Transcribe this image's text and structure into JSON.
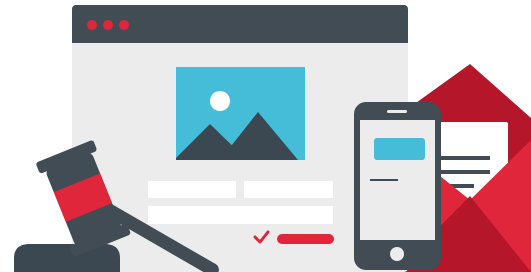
{
  "colors": {
    "window_body": "#ececec",
    "window_titlebar": "#414c55",
    "window_dots": "#e0263a",
    "image_sky": "#45bcd8",
    "image_mountain": "#3b4852",
    "image_sun": "#ffffff",
    "form_fields": "#ffffff",
    "checkmark": "#e0263a",
    "submit_button": "#e0263a",
    "phone_body": "#414c55",
    "phone_screen": "#ececec",
    "phone_bubble": "#45bcd8",
    "phone_home_button": "#ececec",
    "envelope_red": "#e0263a",
    "envelope_dark_red": "#b5162a",
    "letter_paper": "#ffffff",
    "letter_lines": "#414c55",
    "gavel_head": "#414c55",
    "gavel_band": "#e0263a",
    "gavel_handle": "#414c55",
    "gavel_block": "#3b4852"
  },
  "icons": {
    "browser_window": "browser-window-icon",
    "image_placeholder": "image-placeholder-icon",
    "checkmark": "checkmark-icon",
    "smartphone": "smartphone-icon",
    "envelope": "envelope-icon",
    "gavel": "gavel-icon"
  }
}
